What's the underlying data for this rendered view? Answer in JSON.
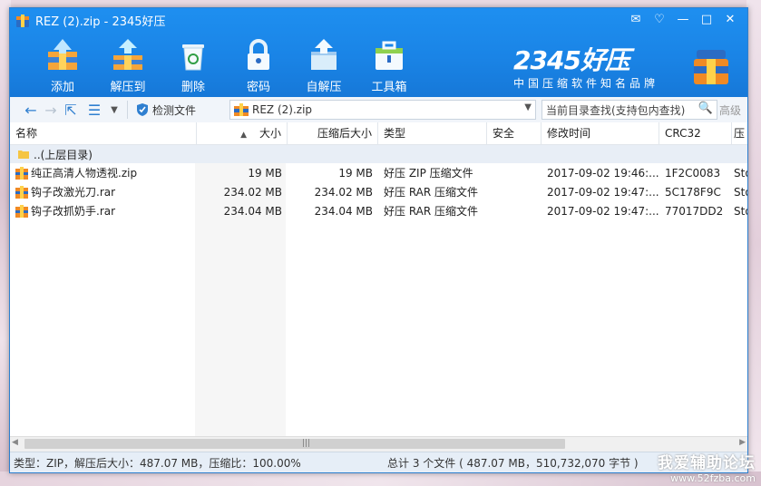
{
  "window": {
    "title": "REZ (2).zip - 2345好压",
    "controls": [
      "feedback-icon",
      "skin-icon",
      "minimize-icon",
      "maximize-icon",
      "close-icon"
    ]
  },
  "toolbar": [
    {
      "label": "添加",
      "icon": "add-archive-icon"
    },
    {
      "label": "解压到",
      "icon": "extract-to-icon"
    },
    {
      "label": "删除",
      "icon": "recycle-bin-icon"
    },
    {
      "label": "密码",
      "icon": "lock-icon"
    },
    {
      "label": "自解压",
      "icon": "self-extract-icon"
    },
    {
      "label": "工具箱",
      "icon": "toolbox-icon"
    }
  ],
  "brand": {
    "name": "2345好压",
    "tagline": "中国压缩软件知名品牌"
  },
  "addressbar": {
    "check_label": "检测文件",
    "path": "REZ (2).zip",
    "search_placeholder": "当前目录查找(支持包内查找)",
    "advanced": "高级"
  },
  "table": {
    "columns": [
      "名称",
      "大小",
      "压缩后大小",
      "类型",
      "安全",
      "修改时间",
      "CRC32",
      "压"
    ],
    "parent_row": "..(上层目录)",
    "rows": [
      {
        "name": "纯正高清人物透视.zip",
        "size": "19 MB",
        "packed": "19 MB",
        "type": "好压 ZIP 压缩文件",
        "security": "",
        "mtime": "2017-09-02 19:46:...",
        "crc": "1F2C0083",
        "method": "Sto"
      },
      {
        "name": "钩子改激光刀.rar",
        "size": "234.02 MB",
        "packed": "234.02 MB",
        "type": "好压 RAR 压缩文件",
        "security": "",
        "mtime": "2017-09-02 19:47:...",
        "crc": "5C178F9C",
        "method": "Sto"
      },
      {
        "name": "钩子改抓奶手.rar",
        "size": "234.04 MB",
        "packed": "234.04 MB",
        "type": "好压 RAR 压缩文件",
        "security": "",
        "mtime": "2017-09-02 19:47:...",
        "crc": "77017DD2",
        "method": "Sto"
      }
    ]
  },
  "status": {
    "left": "类型：ZIP，解压后大小：487.07 MB，压缩比：100.00%",
    "right": "总计 3 个文件 ( 487.07 MB，510,732,070 字节 )"
  },
  "watermark": {
    "line1": "我爱辅助论坛",
    "line2": "www.52fzba.com"
  }
}
